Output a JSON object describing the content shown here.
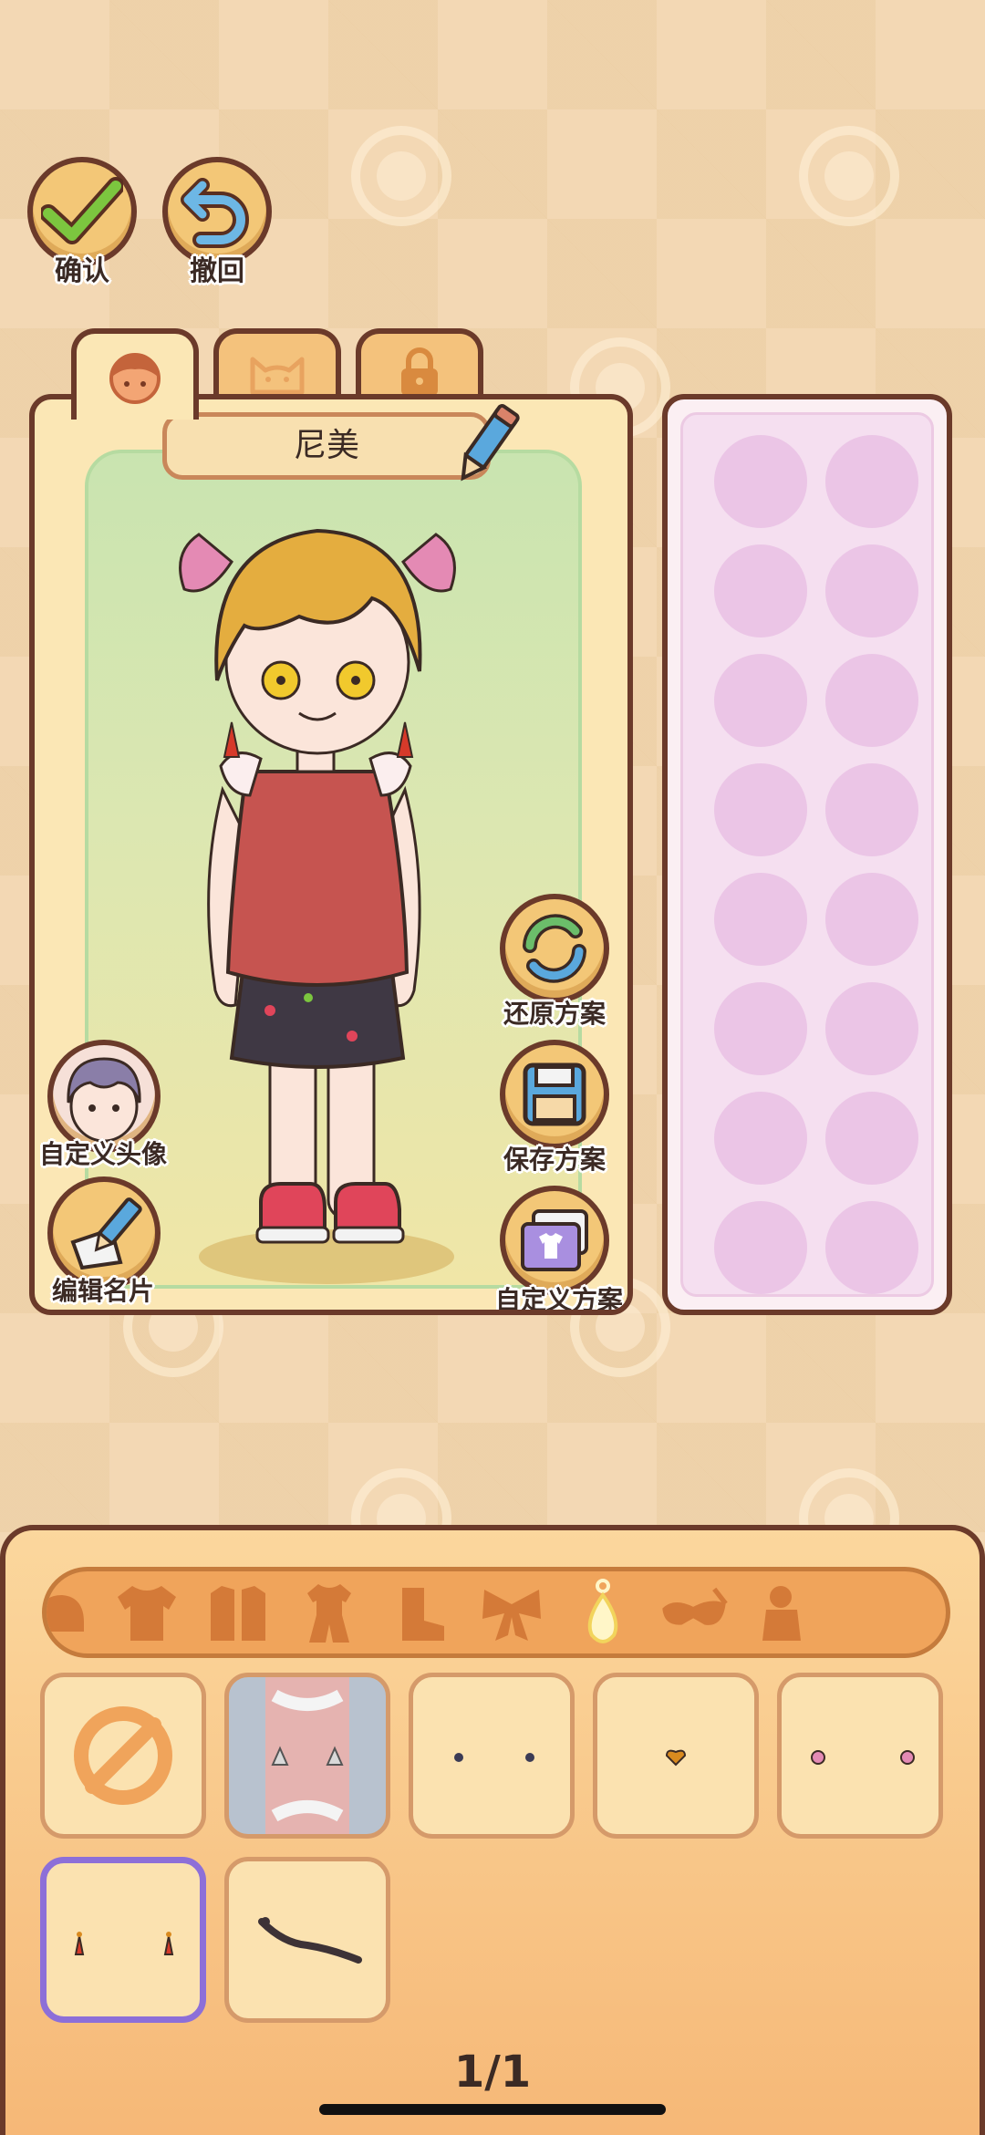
{
  "top_bar": {
    "confirm_label": "确认",
    "undo_label": "撤回"
  },
  "tabs": [
    {
      "icon": "girl-face-icon"
    },
    {
      "icon": "cat-face-icon"
    },
    {
      "icon": "lock-icon"
    }
  ],
  "character": {
    "name": "尼美"
  },
  "side_buttons": {
    "restore_label": "还原方案",
    "save_label": "保存方案",
    "custom_plan_label": "自定义方案",
    "custom_avatar_label": "自定义头像",
    "edit_card_label": "编辑名片"
  },
  "categories": [
    {
      "icon": "hat-icon"
    },
    {
      "icon": "shirt-icon"
    },
    {
      "icon": "coat-icon"
    },
    {
      "icon": "outfit-icon"
    },
    {
      "icon": "boots-icon"
    },
    {
      "icon": "bow-icon"
    },
    {
      "icon": "earring-icon",
      "active": true
    },
    {
      "icon": "mask-icon"
    },
    {
      "icon": "figure-icon"
    }
  ],
  "items": [
    {
      "name": "none",
      "icon": "no-item-icon"
    },
    {
      "name": "shell-earrings",
      "icon": "earring-icon"
    },
    {
      "name": "dark-stud-earrings",
      "icon": "earring-icon"
    },
    {
      "name": "heart-stud-earring",
      "icon": "earring-icon"
    },
    {
      "name": "pink-flower-earrings",
      "icon": "earring-icon"
    },
    {
      "name": "red-tassel-earrings",
      "icon": "earring-icon",
      "selected": true
    },
    {
      "name": "dark-band",
      "icon": "band-icon"
    }
  ],
  "pagination": {
    "page": "1/1"
  },
  "colors": {
    "outline": "#6b3a2a",
    "panel": "#fbe7b5",
    "accent_select": "#8d6fd8",
    "slot_pink": "#ebc5e6"
  }
}
